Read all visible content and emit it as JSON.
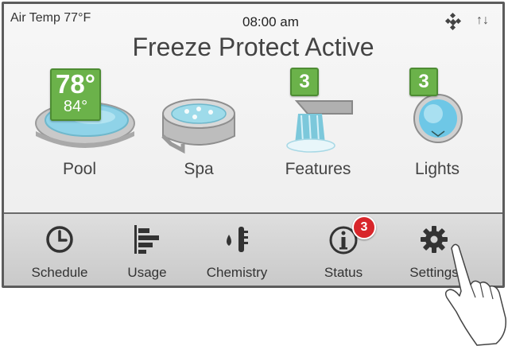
{
  "header": {
    "air_temp": "Air Temp 77°F",
    "time": "08:00 am",
    "status_message": "Freeze Protect Active"
  },
  "tiles": [
    {
      "label": "Pool",
      "current_temp": "78°",
      "set_temp": "84°"
    },
    {
      "label": "Spa"
    },
    {
      "label": "Features",
      "count": "3"
    },
    {
      "label": "Lights",
      "count": "3"
    }
  ],
  "nav": [
    {
      "label": "Schedule",
      "icon": "clock-icon"
    },
    {
      "label": "Usage",
      "icon": "bar-chart-icon"
    },
    {
      "label": "Chemistry",
      "icon": "chemistry-icon"
    },
    {
      "label": "Status",
      "icon": "info-icon",
      "alert_count": "3"
    },
    {
      "label": "Settings",
      "icon": "gear-icon"
    }
  ],
  "colors": {
    "badge_green": "#6bb24a",
    "alert_red": "#d8262b",
    "water_blue": "#8fd3e8"
  }
}
